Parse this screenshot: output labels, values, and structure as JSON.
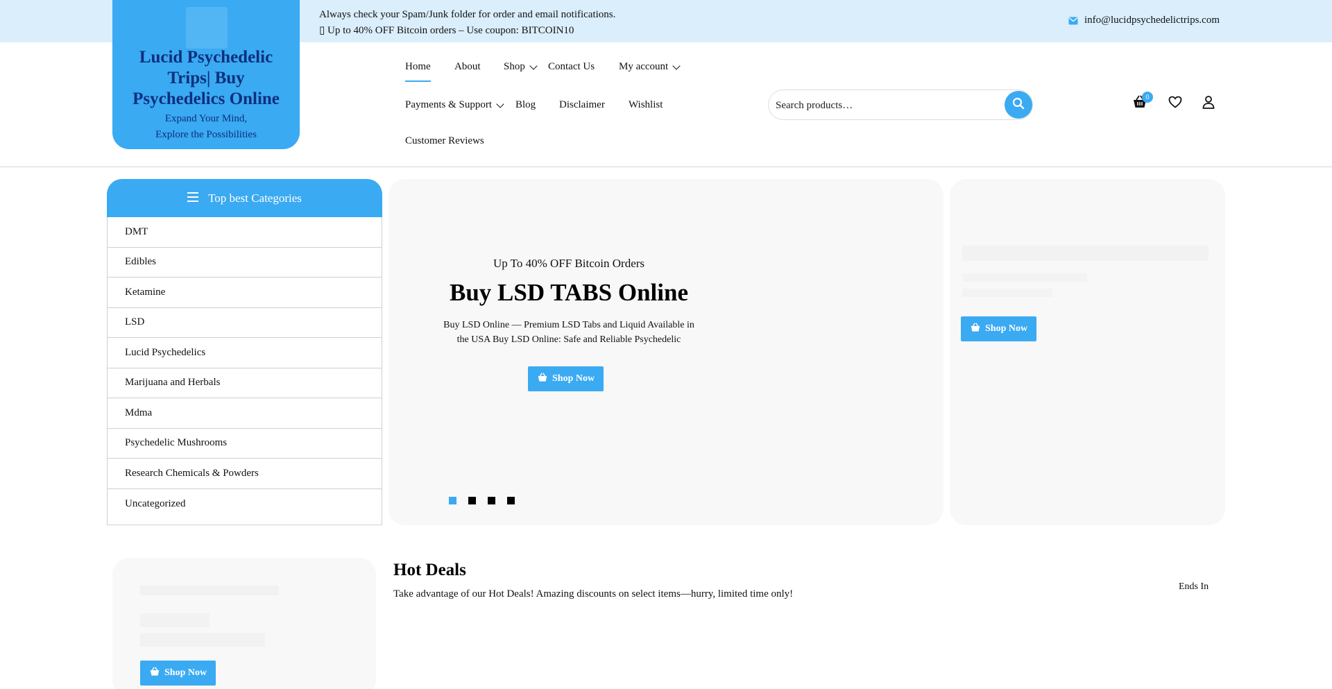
{
  "topbar": {
    "notice_line1": "Always check your Spam/Junk folder for order and email notifications.",
    "notice_line2": "▯ Up to 40% OFF Bitcoin orders – Use coupon: BITCOIN10",
    "email": "info@lucidpsychedelictrips.com",
    "email_icon": "envelope-icon"
  },
  "logo": {
    "title": "Lucid Psychedelic Trips| Buy Psychedelics Online",
    "tagline_line1": "Expand Your Mind,",
    "tagline_line2": "Explore the Possibilities"
  },
  "nav": {
    "home": "Home",
    "about": "About",
    "shop": "Shop",
    "contact": "Contact Us",
    "account": "My account",
    "payments": "Payments & Support",
    "blog": "Blog",
    "disclaimer": "Disclaimer",
    "wishlist": "Wishlist",
    "reviews": "Customer Reviews"
  },
  "search": {
    "placeholder": "Search products…"
  },
  "header_icons": {
    "cart_count": "0"
  },
  "categories": {
    "heading": "Top best Categories",
    "items": [
      "DMT",
      "Edibles",
      "Ketamine",
      "LSD",
      "Lucid Psychedelics",
      "Marijuana and Herbals",
      "Mdma",
      "Psychedelic Mushrooms",
      "Research Chemicals & Powders",
      "Uncategorized"
    ]
  },
  "hero": {
    "subtitle": "Up To 40% OFF Bitcoin Orders",
    "title": "Buy LSD TABS Online",
    "description": "Buy LSD Online — Premium LSD Tabs and Liquid Available in the USA Buy LSD Online: Safe and Reliable Psychedelic",
    "button": "Shop Now",
    "slides": 4,
    "active_slide": 1
  },
  "side_card": {
    "button": "Shop Now"
  },
  "promo_card": {
    "button": "Shop Now"
  },
  "deals": {
    "title": "Hot Deals",
    "description": "Take advantage of our Hot Deals! Amazing discounts on select items—hurry, limited time only!",
    "ends_label": "Ends In"
  },
  "colors": {
    "accent": "#3aaaf2",
    "topbar_bg": "#dbeefb",
    "logo_text": "#0d2f7e"
  }
}
